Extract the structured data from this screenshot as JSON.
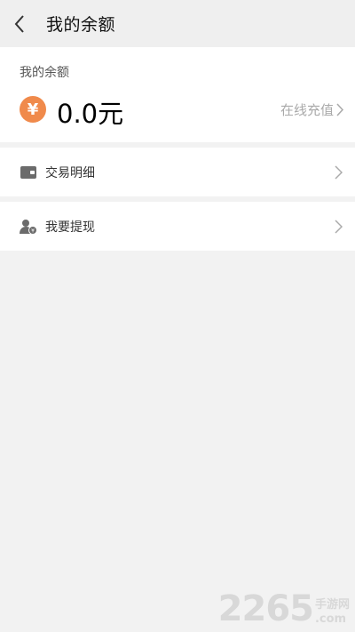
{
  "header": {
    "title": "我的余额",
    "back_icon": "chevron-left-icon"
  },
  "balance": {
    "label": "我的余额",
    "currency_symbol": "¥",
    "amount": "0.0元",
    "recharge_label": "在线充值",
    "accent_color": "#f08a4b"
  },
  "menu": {
    "items": [
      {
        "label": "交易明细",
        "icon": "wallet-icon"
      },
      {
        "label": "我要提现",
        "icon": "user-withdraw-icon"
      }
    ]
  },
  "watermark": {
    "number": "2265",
    "site": "手游网",
    "domain": ".com"
  }
}
